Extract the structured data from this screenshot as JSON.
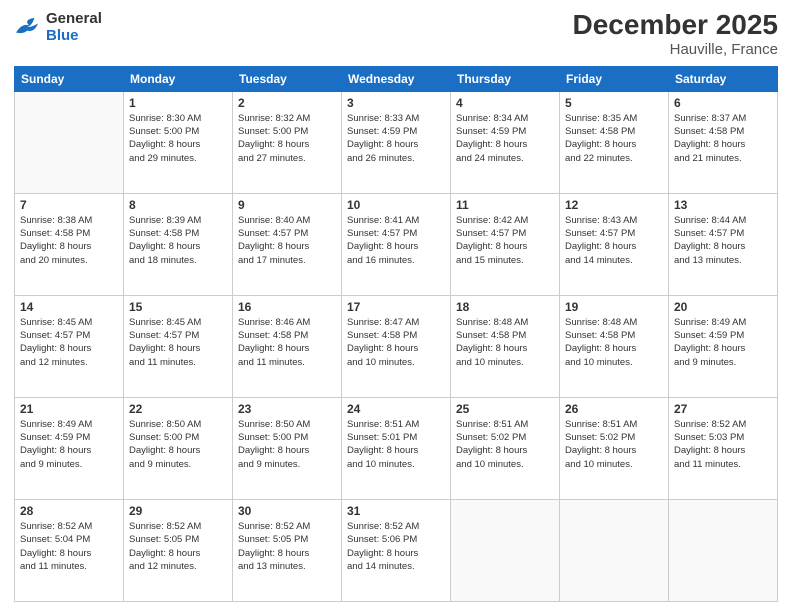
{
  "header": {
    "logo_line1": "General",
    "logo_line2": "Blue",
    "title": "December 2025",
    "subtitle": "Hauville, France"
  },
  "weekdays": [
    "Sunday",
    "Monday",
    "Tuesday",
    "Wednesday",
    "Thursday",
    "Friday",
    "Saturday"
  ],
  "weeks": [
    [
      {
        "day": "",
        "sunrise": "",
        "sunset": "",
        "daylight": ""
      },
      {
        "day": "1",
        "sunrise": "Sunrise: 8:30 AM",
        "sunset": "Sunset: 5:00 PM",
        "daylight": "Daylight: 8 hours and 29 minutes."
      },
      {
        "day": "2",
        "sunrise": "Sunrise: 8:32 AM",
        "sunset": "Sunset: 5:00 PM",
        "daylight": "Daylight: 8 hours and 27 minutes."
      },
      {
        "day": "3",
        "sunrise": "Sunrise: 8:33 AM",
        "sunset": "Sunset: 4:59 PM",
        "daylight": "Daylight: 8 hours and 26 minutes."
      },
      {
        "day": "4",
        "sunrise": "Sunrise: 8:34 AM",
        "sunset": "Sunset: 4:59 PM",
        "daylight": "Daylight: 8 hours and 24 minutes."
      },
      {
        "day": "5",
        "sunrise": "Sunrise: 8:35 AM",
        "sunset": "Sunset: 4:58 PM",
        "daylight": "Daylight: 8 hours and 22 minutes."
      },
      {
        "day": "6",
        "sunrise": "Sunrise: 8:37 AM",
        "sunset": "Sunset: 4:58 PM",
        "daylight": "Daylight: 8 hours and 21 minutes."
      }
    ],
    [
      {
        "day": "7",
        "sunrise": "Sunrise: 8:38 AM",
        "sunset": "Sunset: 4:58 PM",
        "daylight": "Daylight: 8 hours and 20 minutes."
      },
      {
        "day": "8",
        "sunrise": "Sunrise: 8:39 AM",
        "sunset": "Sunset: 4:58 PM",
        "daylight": "Daylight: 8 hours and 18 minutes."
      },
      {
        "day": "9",
        "sunrise": "Sunrise: 8:40 AM",
        "sunset": "Sunset: 4:57 PM",
        "daylight": "Daylight: 8 hours and 17 minutes."
      },
      {
        "day": "10",
        "sunrise": "Sunrise: 8:41 AM",
        "sunset": "Sunset: 4:57 PM",
        "daylight": "Daylight: 8 hours and 16 minutes."
      },
      {
        "day": "11",
        "sunrise": "Sunrise: 8:42 AM",
        "sunset": "Sunset: 4:57 PM",
        "daylight": "Daylight: 8 hours and 15 minutes."
      },
      {
        "day": "12",
        "sunrise": "Sunrise: 8:43 AM",
        "sunset": "Sunset: 4:57 PM",
        "daylight": "Daylight: 8 hours and 14 minutes."
      },
      {
        "day": "13",
        "sunrise": "Sunrise: 8:44 AM",
        "sunset": "Sunset: 4:57 PM",
        "daylight": "Daylight: 8 hours and 13 minutes."
      }
    ],
    [
      {
        "day": "14",
        "sunrise": "Sunrise: 8:45 AM",
        "sunset": "Sunset: 4:57 PM",
        "daylight": "Daylight: 8 hours and 12 minutes."
      },
      {
        "day": "15",
        "sunrise": "Sunrise: 8:45 AM",
        "sunset": "Sunset: 4:57 PM",
        "daylight": "Daylight: 8 hours and 11 minutes."
      },
      {
        "day": "16",
        "sunrise": "Sunrise: 8:46 AM",
        "sunset": "Sunset: 4:58 PM",
        "daylight": "Daylight: 8 hours and 11 minutes."
      },
      {
        "day": "17",
        "sunrise": "Sunrise: 8:47 AM",
        "sunset": "Sunset: 4:58 PM",
        "daylight": "Daylight: 8 hours and 10 minutes."
      },
      {
        "day": "18",
        "sunrise": "Sunrise: 8:48 AM",
        "sunset": "Sunset: 4:58 PM",
        "daylight": "Daylight: 8 hours and 10 minutes."
      },
      {
        "day": "19",
        "sunrise": "Sunrise: 8:48 AM",
        "sunset": "Sunset: 4:58 PM",
        "daylight": "Daylight: 8 hours and 10 minutes."
      },
      {
        "day": "20",
        "sunrise": "Sunrise: 8:49 AM",
        "sunset": "Sunset: 4:59 PM",
        "daylight": "Daylight: 8 hours and 9 minutes."
      }
    ],
    [
      {
        "day": "21",
        "sunrise": "Sunrise: 8:49 AM",
        "sunset": "Sunset: 4:59 PM",
        "daylight": "Daylight: 8 hours and 9 minutes."
      },
      {
        "day": "22",
        "sunrise": "Sunrise: 8:50 AM",
        "sunset": "Sunset: 5:00 PM",
        "daylight": "Daylight: 8 hours and 9 minutes."
      },
      {
        "day": "23",
        "sunrise": "Sunrise: 8:50 AM",
        "sunset": "Sunset: 5:00 PM",
        "daylight": "Daylight: 8 hours and 9 minutes."
      },
      {
        "day": "24",
        "sunrise": "Sunrise: 8:51 AM",
        "sunset": "Sunset: 5:01 PM",
        "daylight": "Daylight: 8 hours and 10 minutes."
      },
      {
        "day": "25",
        "sunrise": "Sunrise: 8:51 AM",
        "sunset": "Sunset: 5:02 PM",
        "daylight": "Daylight: 8 hours and 10 minutes."
      },
      {
        "day": "26",
        "sunrise": "Sunrise: 8:51 AM",
        "sunset": "Sunset: 5:02 PM",
        "daylight": "Daylight: 8 hours and 10 minutes."
      },
      {
        "day": "27",
        "sunrise": "Sunrise: 8:52 AM",
        "sunset": "Sunset: 5:03 PM",
        "daylight": "Daylight: 8 hours and 11 minutes."
      }
    ],
    [
      {
        "day": "28",
        "sunrise": "Sunrise: 8:52 AM",
        "sunset": "Sunset: 5:04 PM",
        "daylight": "Daylight: 8 hours and 11 minutes."
      },
      {
        "day": "29",
        "sunrise": "Sunrise: 8:52 AM",
        "sunset": "Sunset: 5:05 PM",
        "daylight": "Daylight: 8 hours and 12 minutes."
      },
      {
        "day": "30",
        "sunrise": "Sunrise: 8:52 AM",
        "sunset": "Sunset: 5:05 PM",
        "daylight": "Daylight: 8 hours and 13 minutes."
      },
      {
        "day": "31",
        "sunrise": "Sunrise: 8:52 AM",
        "sunset": "Sunset: 5:06 PM",
        "daylight": "Daylight: 8 hours and 14 minutes."
      },
      {
        "day": "",
        "sunrise": "",
        "sunset": "",
        "daylight": ""
      },
      {
        "day": "",
        "sunrise": "",
        "sunset": "",
        "daylight": ""
      },
      {
        "day": "",
        "sunrise": "",
        "sunset": "",
        "daylight": ""
      }
    ]
  ]
}
